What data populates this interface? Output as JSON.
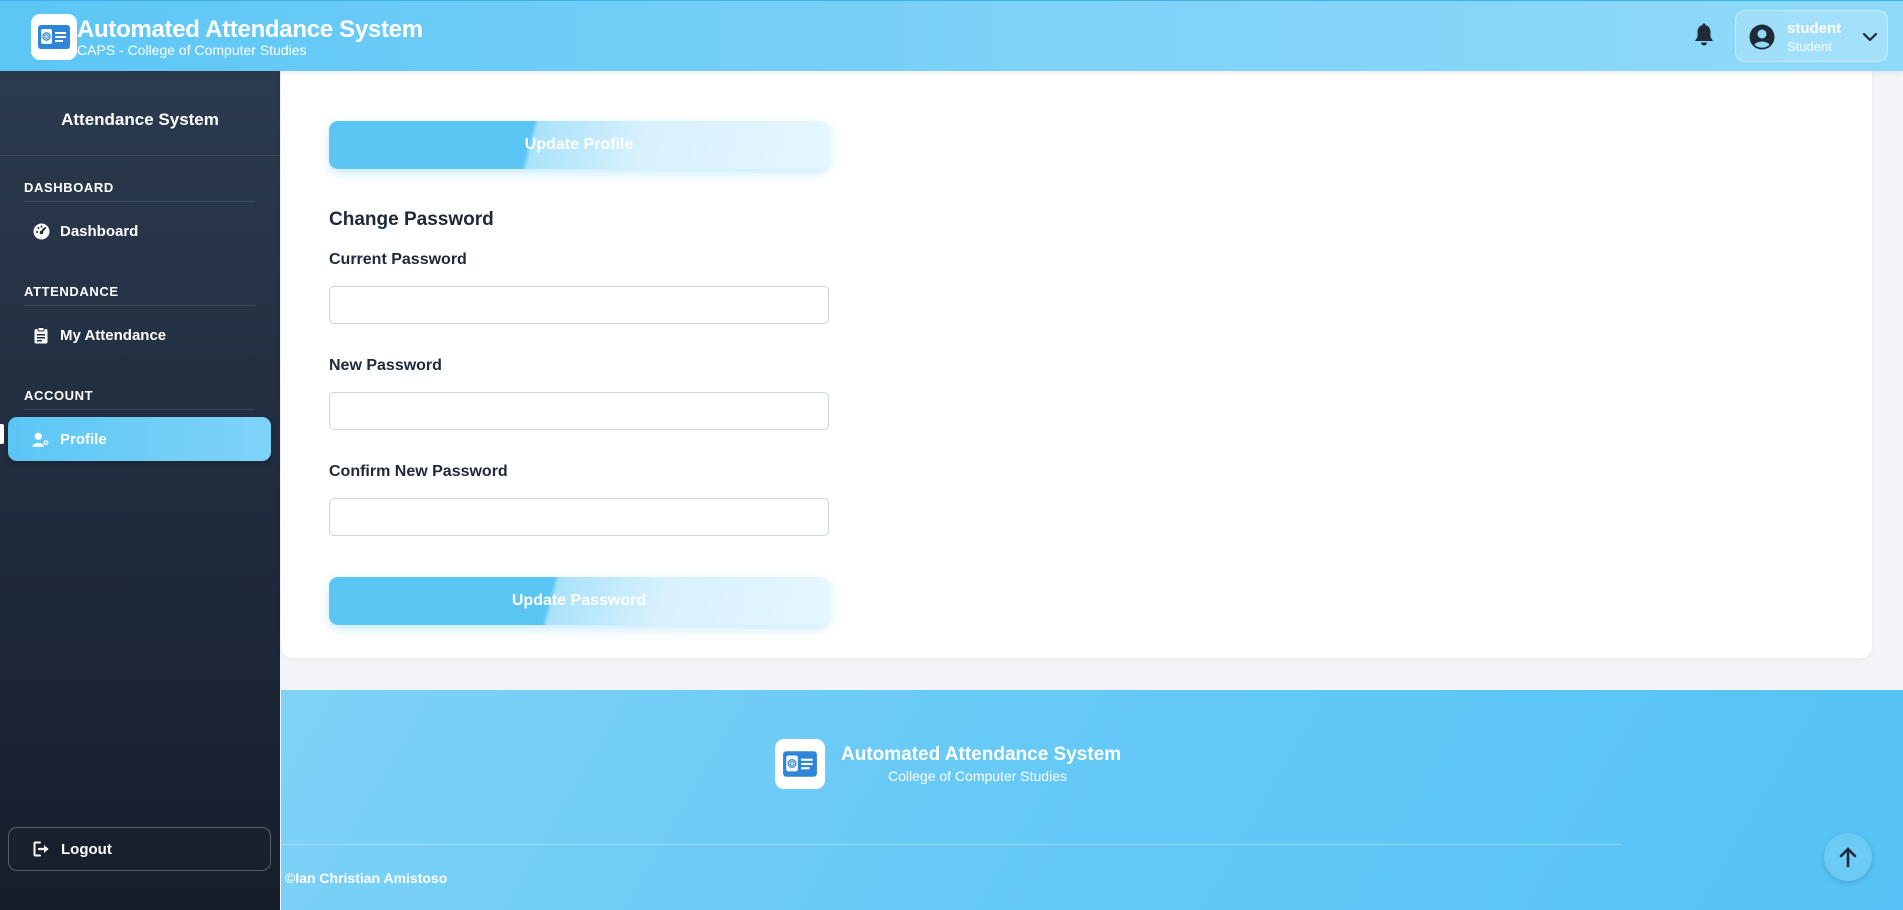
{
  "header": {
    "app_title": "Automated Attendance System",
    "app_subtitle": "CAPS - College of Computer Studies",
    "notification_icon": "bell-icon",
    "user": {
      "name": "student",
      "role": "Student"
    }
  },
  "sidebar": {
    "title": "Attendance System",
    "sections": [
      {
        "label": "DASHBOARD",
        "items": [
          {
            "label": "Dashboard",
            "icon": "gauge-icon"
          }
        ]
      },
      {
        "label": "ATTENDANCE",
        "items": [
          {
            "label": "My Attendance",
            "icon": "clipboard-icon"
          }
        ]
      },
      {
        "label": "ACCOUNT",
        "items": [
          {
            "label": "Profile",
            "icon": "user-gear-icon",
            "active": true
          }
        ]
      }
    ],
    "logout_label": "Logout"
  },
  "main": {
    "update_profile_label": "Update Profile",
    "change_password_heading": "Change Password",
    "fields": {
      "current_password": {
        "label": "Current Password",
        "value": ""
      },
      "new_password": {
        "label": "New Password",
        "value": ""
      },
      "confirm_password": {
        "label": "Confirm New Password",
        "value": ""
      }
    },
    "update_password_label": "Update Password"
  },
  "footer": {
    "title": "Automated Attendance System",
    "subtitle": "College of Computer Studies",
    "copyright": "©Ian Christian Amistoso"
  },
  "colors": {
    "accent": "#5cc6f5",
    "sidebar_dark": "#1f2a3b",
    "icon_blue": "#2f86d9"
  }
}
